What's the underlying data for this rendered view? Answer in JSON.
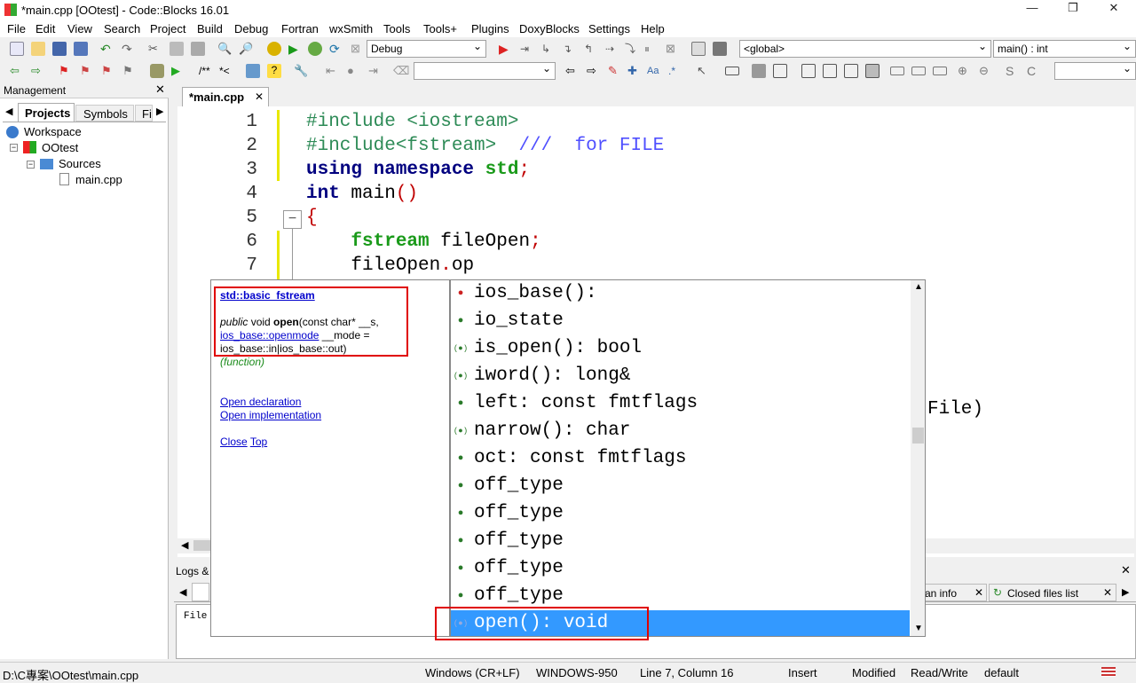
{
  "title": "*main.cpp [OOtest] - Code::Blocks 16.01",
  "menu": [
    "File",
    "Edit",
    "View",
    "Search",
    "Project",
    "Build",
    "Debug",
    "Fortran",
    "wxSmith",
    "Tools",
    "Tools+",
    "Plugins",
    "DoxyBlocks",
    "Settings",
    "Help"
  ],
  "toolbar": {
    "build_target": "Debug",
    "scope": "<global>",
    "function": "main() : int"
  },
  "management": {
    "title": "Management",
    "tabs": [
      "Projects",
      "Symbols",
      "Fi"
    ],
    "tree": [
      "Workspace",
      "OOtest",
      "Sources",
      "main.cpp"
    ]
  },
  "editor": {
    "tab": "*main.cpp",
    "line_numbers": [
      "1",
      "2",
      "3",
      "4",
      "5",
      "6",
      "7"
    ],
    "lines": [
      {
        "parts": [
          [
            "#include <iostream>",
            "pp"
          ]
        ]
      },
      {
        "parts": [
          [
            "#include<fstream>  ",
            "pp"
          ],
          [
            "///  for FILE",
            "doc"
          ]
        ]
      },
      {
        "parts": [
          [
            "using namespace ",
            "kw"
          ],
          [
            "std",
            "kw2"
          ],
          [
            ";",
            "punc"
          ]
        ]
      },
      {
        "parts": [
          [
            "int",
            "kw"
          ],
          [
            " main",
            "id"
          ],
          [
            "()",
            "punc"
          ]
        ]
      },
      {
        "parts": [
          [
            "{",
            "punc"
          ]
        ]
      },
      {
        "parts": [
          [
            "    ",
            "id"
          ],
          [
            "fstream",
            "kw2"
          ],
          [
            " fileOpen",
            "id"
          ],
          [
            ";",
            "punc"
          ]
        ]
      },
      {
        "parts": [
          [
            "    fileOpen",
            "id"
          ],
          [
            ".",
            "punc"
          ],
          [
            "op",
            "id"
          ]
        ]
      }
    ],
    "hidden_tail": "File)"
  },
  "doc_popup": {
    "class_link": "std::basic_fstream",
    "sig_prefix": "public",
    "sig_ret": " void ",
    "sig_name": "open",
    "sig_args1": "(const char* __s,",
    "sig_link": "ios_base::openmode",
    "sig_args2": " __mode =",
    "sig_args3": "ios_base::in|ios_base::out)",
    "kind": "(function)",
    "open_decl": "Open declaration",
    "open_impl": "Open implementation",
    "close": "Close",
    "top": "Top"
  },
  "completion": [
    "ios_base():",
    "io_state",
    "is_open(): bool",
    "iword(): long&",
    "left: const fmtflags",
    "narrow(): char",
    "oct: const fmtflags",
    "off_type",
    "off_type",
    "off_type",
    "off_type",
    "off_type",
    "open(): void"
  ],
  "logs": {
    "title": "Logs & o",
    "text": "File",
    "tab_info": "an info",
    "tab_closed": "Closed files list"
  },
  "status": {
    "path": "D:\\C專案\\OOtest\\main.cpp",
    "eol": "Windows (CR+LF)",
    "enc": "WINDOWS-950",
    "pos": "Line 7, Column 16",
    "mode": "Insert",
    "mod": "Modified",
    "rw": "Read/Write",
    "lang": "default"
  },
  "colors": {
    "pp": "#2e8b57",
    "kw": "#00007f",
    "kw2": "#1a9a1a",
    "doc": "#5050ff",
    "punc": "#c00000",
    "id": "#000000"
  }
}
